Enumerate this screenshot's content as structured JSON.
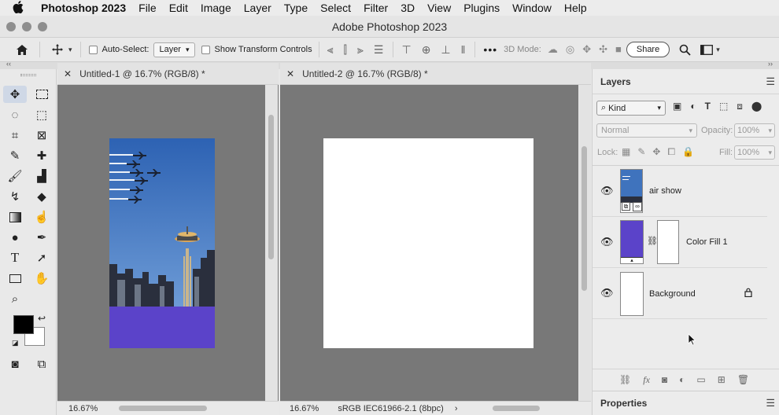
{
  "menubar": {
    "app": "Photoshop 2023",
    "items": [
      "File",
      "Edit",
      "Image",
      "Layer",
      "Type",
      "Select",
      "Filter",
      "3D",
      "View",
      "Plugins",
      "Window",
      "Help"
    ]
  },
  "window": {
    "title": "Adobe Photoshop 2023"
  },
  "options": {
    "auto_select_label": "Auto-Select:",
    "auto_select_value": "Layer",
    "transform_label": "Show Transform Controls",
    "mode_3d_label": "3D Mode:",
    "share_label": "Share"
  },
  "documents": [
    {
      "tab": "Untitled-1 @ 16.7% (RGB/8) *",
      "zoom": "16.67%"
    },
    {
      "tab": "Untitled-2 @ 16.7% (RGB/8) *",
      "zoom": "16.67%",
      "profile": "sRGB IEC61966-2.1 (8bpc)"
    }
  ],
  "layers_panel": {
    "tab": "Layers",
    "kind": "Kind",
    "blend": "Normal",
    "opacity_label": "Opacity:",
    "opacity_value": "100%",
    "lock_label": "Lock:",
    "fill_label": "Fill:",
    "fill_value": "100%",
    "layers": [
      {
        "name": "air show"
      },
      {
        "name": "Color Fill 1"
      },
      {
        "name": "Background"
      }
    ]
  },
  "properties_panel": {
    "tab": "Properties"
  },
  "colors": {
    "fill_purple": "#5b43c9",
    "sky": "#3f73bd",
    "canvas_bg": "#787878"
  }
}
